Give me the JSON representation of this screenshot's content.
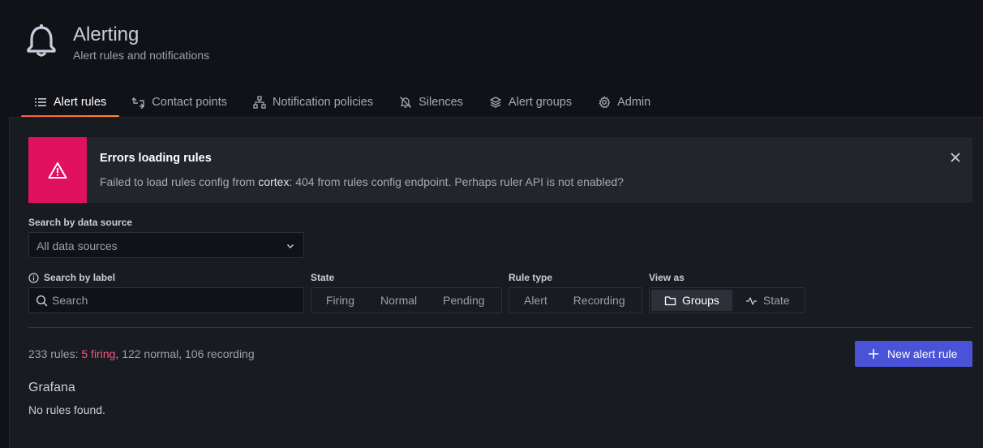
{
  "header": {
    "title": "Alerting",
    "subtitle": "Alert rules and notifications",
    "icon": "bell-icon"
  },
  "tabs": [
    {
      "label": "Alert rules",
      "icon": "list-icon",
      "active": true
    },
    {
      "label": "Contact points",
      "icon": "contact-icon",
      "active": false
    },
    {
      "label": "Notification policies",
      "icon": "sitemap-icon",
      "active": false
    },
    {
      "label": "Silences",
      "icon": "bell-slash-icon",
      "active": false
    },
    {
      "label": "Alert groups",
      "icon": "layers-icon",
      "active": false
    },
    {
      "label": "Admin",
      "icon": "cog-icon",
      "active": false
    }
  ],
  "error_alert": {
    "title": "Errors loading rules",
    "message_prefix": "Failed to load rules config from ",
    "message_highlight": "cortex",
    "message_suffix": ": 404 from rules config endpoint. Perhaps ruler API is not enabled?",
    "color": "#e0115f"
  },
  "filters": {
    "datasource": {
      "label": "Search by data source",
      "value": "All data sources"
    },
    "search": {
      "label": "Search by label",
      "placeholder": "Search",
      "value": ""
    },
    "state": {
      "label": "State",
      "options": [
        "Firing",
        "Normal",
        "Pending"
      ]
    },
    "rule_type": {
      "label": "Rule type",
      "options": [
        "Alert",
        "Recording"
      ]
    },
    "view_as": {
      "label": "View as",
      "options": [
        "Groups",
        "State"
      ],
      "selected": "Groups"
    }
  },
  "summary": {
    "total": "233 rules: ",
    "firing": "5 firing",
    "sep1": ", ",
    "normal": "122 normal",
    "sep2": ", ",
    "recording": "106 recording"
  },
  "actions": {
    "new_rule_label": "New alert rule"
  },
  "grafana_section": {
    "title": "Grafana",
    "empty": "No rules found."
  }
}
